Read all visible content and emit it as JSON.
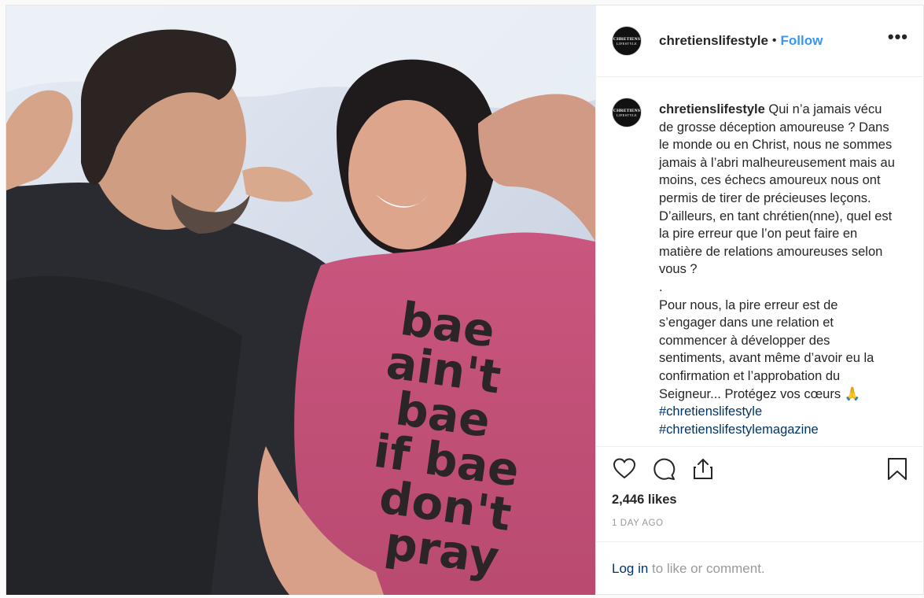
{
  "post": {
    "shirt_text": [
      "bae",
      "ain't",
      "bae",
      "if bae",
      "don't",
      "pray"
    ],
    "avatar_text": [
      "CHRETIENS",
      "LIFESTYLE"
    ]
  },
  "header": {
    "username": "chretienslifestyle",
    "separator": "•",
    "follow_label": "Follow",
    "more_label": "•••"
  },
  "caption": {
    "username": "chretienslifestyle",
    "text": "Qui n’a jamais vécu de grosse déception amoureuse ? Dans le monde ou en Christ, nous ne sommes jamais à l’abri malheureusement mais au moins, ces échecs amoureux nous ont permis de tirer de précieuses leçons. D’ailleurs, en tant chrétien(nne), quel est la pire erreur que l’on peut faire en matière de relations amoureuses selon vous ?\n.\nPour nous, la pire erreur est de s’engager dans une relation et commencer à développer des sentiments, avant même d’avoir eu la confirmation et l’approbation du Seigneur... Protégez vos cœurs 🙏",
    "hashtags": [
      "#chretienslifestyle",
      "#chretienslifestylemagazine"
    ]
  },
  "actions": {
    "icons": [
      "heart-icon",
      "comment-icon",
      "share-icon",
      "bookmark-icon"
    ]
  },
  "likes_text": "2,446 likes",
  "timestamp": "1 DAY AGO",
  "login": {
    "link_label": "Log in",
    "suffix": " to like or comment."
  },
  "colors": {
    "link": "#3897f0",
    "hashtag": "#003569",
    "shirt": "#c14e76"
  }
}
